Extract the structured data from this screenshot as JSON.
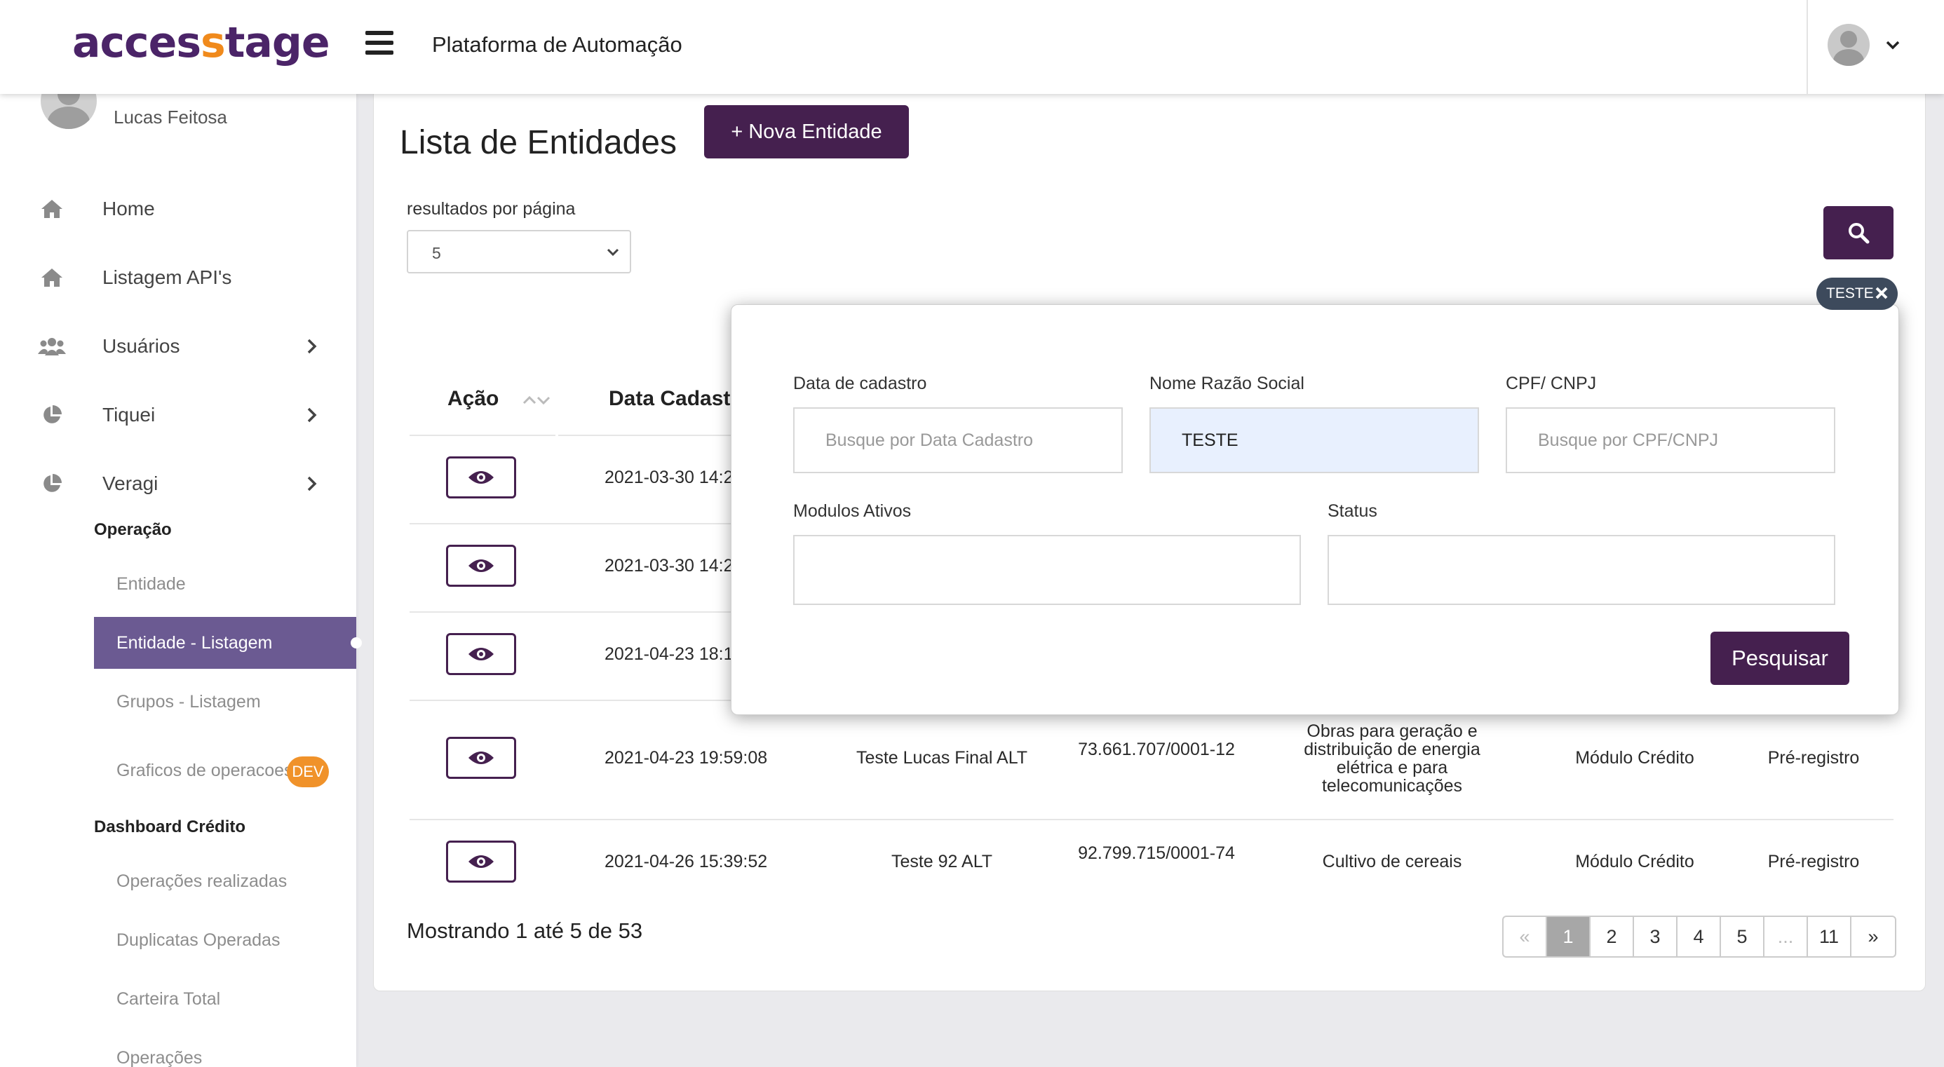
{
  "header": {
    "logo_part1": "acces",
    "logo_part2": "s",
    "logo_part3": "tage",
    "app_title": "Plataforma de Automação"
  },
  "sidebar": {
    "username": "Lucas Feitosa",
    "items": [
      {
        "label": "Home",
        "icon": "home-icon"
      },
      {
        "label": "Listagem API's",
        "icon": "home-icon"
      },
      {
        "label": "Usuários",
        "icon": "users-icon"
      },
      {
        "label": "Tiquei",
        "icon": "pie-chart-icon"
      },
      {
        "label": "Veragi",
        "icon": "pie-chart-icon"
      }
    ],
    "section_operacao": "Operação",
    "operacao_items": [
      "Entidade",
      "Entidade - Listagem",
      "Grupos - Listagem",
      "Graficos de operacoes"
    ],
    "dev_badge": "DEV",
    "section_dashboard": "Dashboard Crédito",
    "dashboard_items": [
      "Operações realizadas",
      "Duplicatas Operadas",
      "Carteira Total",
      "Operações"
    ]
  },
  "main": {
    "title": "Lista de Entidades",
    "new_button": "+ Nova Entidade",
    "rpp_label": "resultados por página",
    "rpp_value": "5",
    "chip_label": "TESTE",
    "col_acao": "Ação",
    "col_data": "Data Cadastr",
    "rows": [
      {
        "date": "2021-03-30 14:2",
        "nome": "",
        "cnpj": "",
        "atividade": "",
        "modulo": "",
        "status": ""
      },
      {
        "date": "2021-03-30 14:2",
        "nome": "",
        "cnpj": "",
        "atividade": "",
        "modulo": "",
        "status": ""
      },
      {
        "date": "2021-04-23 18:1",
        "nome": "",
        "cnpj": "",
        "atividade": "",
        "modulo": "",
        "status": ""
      },
      {
        "date": "2021-04-23 19:59:08",
        "nome": "Teste Lucas Final ALT",
        "cnpj": "73.661.707/0001-12",
        "atividade": "Obras para geração e distribuição de energia elétrica e para telecomunicações",
        "modulo": "Módulo Crédito",
        "status": "Pré-registro"
      },
      {
        "date": "2021-04-26 15:39:52",
        "nome": "Teste 92 ALT",
        "cnpj": "92.799.715/0001-74",
        "atividade": "Cultivo de cereais",
        "modulo": "Módulo Crédito",
        "status": "Pré-registro"
      }
    ],
    "showing": "Mostrando 1 até 5 de 53",
    "pagination": [
      "«",
      "1",
      "2",
      "3",
      "4",
      "5",
      "...",
      "11",
      "»"
    ]
  },
  "filter": {
    "data_label": "Data de cadastro",
    "data_placeholder": "Busque por Data Cadastro",
    "nome_label": "Nome Razão Social",
    "nome_value": "TESTE",
    "cpf_label": "CPF/ CNPJ",
    "cpf_placeholder": "Busque por CPF/CNPJ",
    "modulos_label": "Modulos Ativos",
    "status_label": "Status",
    "search_button": "Pesquisar"
  },
  "colors": {
    "brand_purple": "#45204f",
    "brand_orange": "#f08a1c",
    "active_nav": "#6b5a92"
  }
}
